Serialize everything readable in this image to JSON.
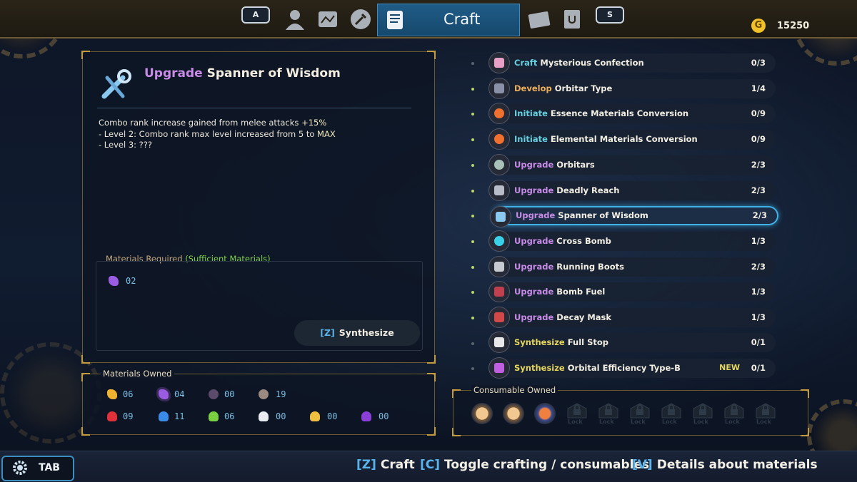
{
  "header": {
    "left_key": "A",
    "right_key": "S",
    "active_tab_label": "Craft",
    "tabs": [
      "profile-icon",
      "map-icon",
      "wrench-icon",
      "craft-scroll-icon",
      "envelope-icon",
      "journal-icon"
    ],
    "gold_symbol": "G",
    "gold_amount": "15250"
  },
  "detail": {
    "action": "Upgrade",
    "item": "Spanner of Wisdom",
    "desc_line1_a": "Combo rank increase gained from melee attacks ",
    "desc_line1_b": "+15%",
    "desc_line2_a": "- Level 2: Combo rank max level increased from 5 to ",
    "desc_line2_b": "MAX",
    "desc_line3": "- Level 3: ???",
    "materials_required_label": "Materials Required ",
    "materials_required_status": "(Sufficient Materials)",
    "required_qty": "02",
    "synth_key": "[Z]",
    "synth_label": "Synthesize"
  },
  "materials_owned": {
    "label": "Materials Owned",
    "row1": [
      "06",
      "04",
      "00",
      "19"
    ],
    "row2": [
      "09",
      "11",
      "06",
      "00",
      "00",
      "00"
    ],
    "colors_row1": [
      "#f0b330",
      "#9a5ce0",
      "#5c4a6a",
      "#9a8a80"
    ],
    "colors_row2": [
      "#e0303a",
      "#3a8ae8",
      "#7ad040",
      "#e8ecf0",
      "#f0c040",
      "#8a40d8"
    ]
  },
  "quests": [
    {
      "action": "Craft",
      "type": "craft",
      "name": "Mysterious Confection",
      "count": "0/3",
      "new": ""
    },
    {
      "action": "Develop",
      "type": "develop",
      "name": "Orbitar Type",
      "count": "1/4",
      "new": ""
    },
    {
      "action": "Initiate",
      "type": "initiate",
      "name": "Essence Materials Conversion",
      "count": "0/9",
      "new": ""
    },
    {
      "action": "Initiate",
      "type": "initiate",
      "name": "Elemental Materials Conversion",
      "count": "0/9",
      "new": ""
    },
    {
      "action": "Upgrade",
      "type": "upgrade",
      "name": "Orbitars",
      "count": "2/3",
      "new": ""
    },
    {
      "action": "Upgrade",
      "type": "upgrade",
      "name": "Deadly Reach",
      "count": "2/3",
      "new": ""
    },
    {
      "action": "Upgrade",
      "type": "upgrade",
      "name": "Spanner of Wisdom",
      "count": "2/3",
      "new": ""
    },
    {
      "action": "Upgrade",
      "type": "upgrade",
      "name": "Cross Bomb",
      "count": "1/3",
      "new": ""
    },
    {
      "action": "Upgrade",
      "type": "upgrade",
      "name": "Running Boots",
      "count": "2/3",
      "new": ""
    },
    {
      "action": "Upgrade",
      "type": "upgrade",
      "name": "Bomb Fuel",
      "count": "1/3",
      "new": ""
    },
    {
      "action": "Upgrade",
      "type": "upgrade",
      "name": "Decay Mask",
      "count": "1/3",
      "new": ""
    },
    {
      "action": "Synthesize",
      "type": "synth",
      "name": "Full Stop",
      "count": "0/1",
      "new": ""
    },
    {
      "action": "Synthesize",
      "type": "synth",
      "name": "Orbital Efficiency Type-B",
      "count": "0/1",
      "new": "NEW"
    }
  ],
  "consumables": {
    "label": "Consumable Owned",
    "lock_label": "Lock"
  },
  "footer": {
    "tab_label": "TAB",
    "hint_craft_key": "[Z]",
    "hint_craft": "Craft",
    "hint_toggle_key": "[C]",
    "hint_toggle": "Toggle crafting / consumables",
    "hint_details_key": "[V]",
    "hint_details": "Details about materials"
  }
}
